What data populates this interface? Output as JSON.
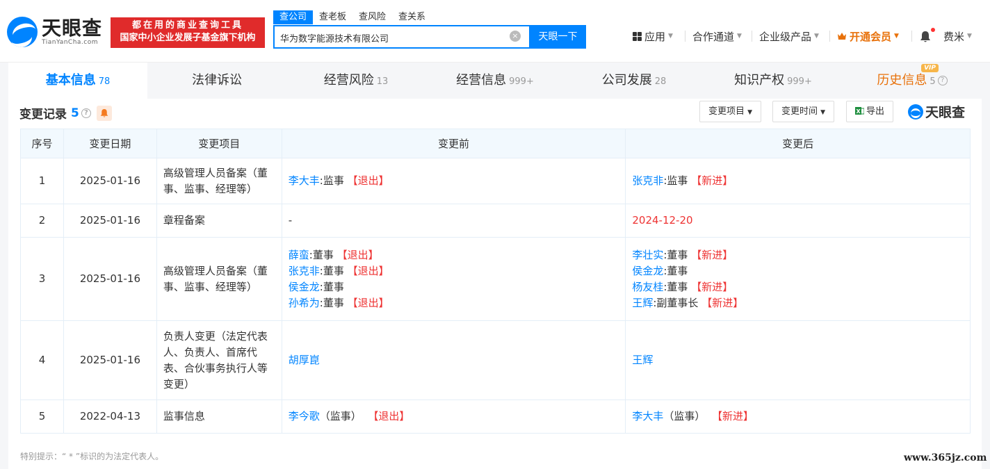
{
  "header": {
    "logo_cn": "天眼查",
    "logo_en": "TianYanCha.com",
    "slogan_line1": "都在用的商业查询工具",
    "slogan_line2": "国家中小企业发展子基金旗下机构",
    "search_tabs": [
      "查公司",
      "查老板",
      "查风险",
      "查关系"
    ],
    "search_value": "华为数字能源技术有限公司",
    "search_button": "天眼一下",
    "nav": {
      "apps": "应用",
      "channel": "合作通道",
      "enterprise": "企业级产品",
      "vip": "开通会员",
      "user": "费米"
    }
  },
  "tabs": [
    {
      "label": "基本信息",
      "count": "78"
    },
    {
      "label": "法律诉讼",
      "count": ""
    },
    {
      "label": "经营风险",
      "count": "13"
    },
    {
      "label": "经营信息",
      "count": "999+"
    },
    {
      "label": "公司发展",
      "count": "28"
    },
    {
      "label": "知识产权",
      "count": "999+"
    },
    {
      "label": "历史信息",
      "count": "5",
      "badge": "VIP"
    }
  ],
  "section": {
    "title": "变更记录",
    "count": "5",
    "filter_item": "变更项目",
    "filter_time": "变更时间",
    "export": "导出",
    "brand": "天眼查"
  },
  "table": {
    "headers": [
      "序号",
      "变更日期",
      "变更项目",
      "变更前",
      "变更后"
    ],
    "rows": [
      {
        "idx": "1",
        "date": "2025-01-16",
        "item": "高级管理人员备案（董事、监事、经理等）"
      },
      {
        "idx": "2",
        "date": "2025-01-16",
        "item": "章程备案"
      },
      {
        "idx": "3",
        "date": "2025-01-16",
        "item": "高级管理人员备案（董事、监事、经理等）"
      },
      {
        "idx": "4",
        "date": "2025-01-16",
        "item": "负责人变更（法定代表人、负责人、首席代表、合伙事务执行人等变更）"
      },
      {
        "idx": "5",
        "date": "2022-04-13",
        "item": "监事信息"
      }
    ],
    "r1_before": {
      "name": "李大丰",
      "role": ":监事",
      "tag": "【退出】"
    },
    "r1_after": {
      "name": "张克非",
      "role": ":监事",
      "tag": "【新进】"
    },
    "r2_before": "-",
    "r2_after": "2024-12-20",
    "r3_before": [
      {
        "name": "薛蛮",
        "role": ":董事",
        "tag": "【退出】"
      },
      {
        "name": "张克非",
        "role": ":董事",
        "tag": "【退出】"
      },
      {
        "name": "侯金龙",
        "role": ":董事",
        "tag": ""
      },
      {
        "name": "孙希为",
        "role": ":董事",
        "tag": "【退出】"
      }
    ],
    "r3_after": [
      {
        "name": "李壮实",
        "role": ":董事",
        "tag": "【新进】"
      },
      {
        "name": "侯金龙",
        "role": ":董事",
        "tag": ""
      },
      {
        "name": "杨友桂",
        "role": ":董事",
        "tag": "【新进】"
      },
      {
        "name": "王辉",
        "role": ":副董事长",
        "tag": "【新进】"
      }
    ],
    "r4_before": "胡厚崑",
    "r4_after": "王辉",
    "r5_before": {
      "name": "李今歌",
      "role": "（监事）",
      "tag": "【退出】"
    },
    "r5_after": {
      "name": "李大丰",
      "role": "（监事）",
      "tag": "【新进】"
    }
  },
  "note": "特别提示：“ * ”标识的为法定代表人。",
  "watermark": "www.365jz.com",
  "colors": {
    "accent": "#0084ff",
    "red": "#e33333",
    "vip": "#e8710a"
  }
}
